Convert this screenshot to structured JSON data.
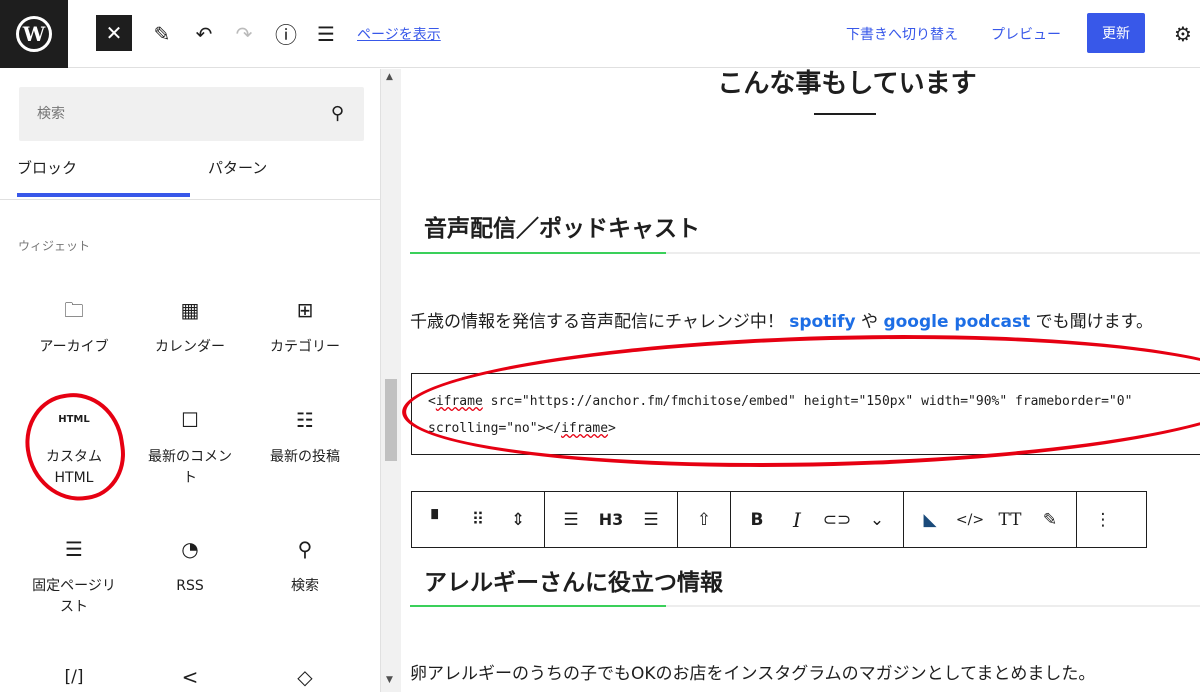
{
  "topbar": {
    "logo": "W",
    "close_icon": "✕",
    "pen_icon": "✎",
    "undo_icon": "↶",
    "redo_icon": "↷",
    "info_icon": "ⓘ",
    "list_icon": "☰",
    "view_page": "ページを表示",
    "switch_draft": "下書きへ切り替え",
    "preview": "プレビュー",
    "update": "更新",
    "gear_icon": "⚙"
  },
  "sidebar": {
    "search_placeholder": "検索",
    "search_icon": "⚲",
    "tabs": [
      "ブロック",
      "パターン"
    ],
    "category": "ウィジェット",
    "blocks": [
      {
        "icon": "🗀",
        "label": "アーカイブ"
      },
      {
        "icon": "▦",
        "label": "カレンダー"
      },
      {
        "icon": "⊞",
        "label": "カテゴリー"
      },
      {
        "icon": "HTML",
        "label": "カスタム HTML"
      },
      {
        "icon": "☐",
        "label": "最新のコメント"
      },
      {
        "icon": "☷",
        "label": "最新の投稿"
      },
      {
        "icon": "☰",
        "label": "固定ページリスト"
      },
      {
        "icon": "◔",
        "label": "RSS"
      },
      {
        "icon": "⚲",
        "label": "検索"
      },
      {
        "icon": "[/]",
        "label": ""
      },
      {
        "icon": "<",
        "label": ""
      },
      {
        "icon": "◇",
        "label": ""
      }
    ]
  },
  "content": {
    "top_heading": "こんな事もしています",
    "heading1": "音声配信／ポッドキャスト",
    "para1_pre": "千歳の情報を発信する音声配信にチャレンジ中！ ",
    "para1_link1": "spotify",
    "para1_mid": " や ",
    "para1_link2": "google podcast",
    "para1_post": " でも聞けます。",
    "code": {
      "lt1": "<",
      "tag1": "iframe",
      "line1_rest": " src=\"https://anchor.fm/fmchitose/embed\" height=\"150px\" width=\"90%\" frameborder=\"0\"",
      "line2_pre": "scrolling=\"no\"></",
      "tag2": "iframe",
      "gt2": ">"
    },
    "heading2": "アレルギーさんに役立つ情報",
    "para2": "卵アレルギーのうちの子でもOKのお店をインスタグラムのマガジンとしてまとめました。"
  },
  "block_toolbar": {
    "bookmark": "▘",
    "drag": "⠿",
    "move": "⇕",
    "align": "☰",
    "heading_level": "H3",
    "text_align": "☰",
    "toc": "⇧",
    "bold": "B",
    "italic": "I",
    "link": "⊂⊃",
    "more_rich": "⌄",
    "marker": "◣",
    "code": "</>",
    "font_size": "TT",
    "highlight": "✎",
    "options": "⋮"
  }
}
